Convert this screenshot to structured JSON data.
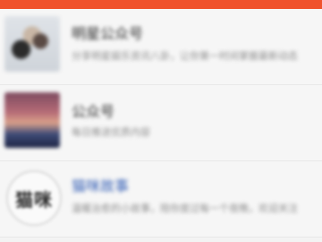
{
  "header": {
    "color": "#f0522c"
  },
  "list": {
    "items": [
      {
        "title": "明星公众号",
        "desc": "分享明星娱乐资讯八卦，让你第一时间掌握最新动态",
        "thumb": "photo-people"
      },
      {
        "title": "公众号",
        "desc": "每日推送优质内容",
        "thumb": "photo-sunset"
      },
      {
        "title": "猫咪故事",
        "desc": "温暖治愈的小故事，陪你度过每一个夜晚，欢迎关注",
        "thumb": "logo-circle",
        "logo_text": "猫咪",
        "title_color": "#3a63b7"
      }
    ]
  }
}
